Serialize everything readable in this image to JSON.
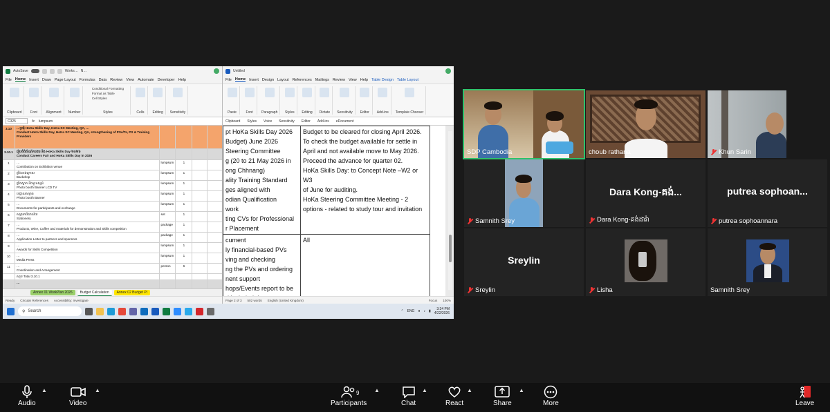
{
  "excel": {
    "autosave": "AutoSave",
    "title": "Works…",
    "title2": "N…",
    "tabs": [
      "File",
      "Home",
      "Insert",
      "Draw",
      "Page Layout",
      "Formulas",
      "Data",
      "Review",
      "View",
      "Automate",
      "Developer",
      "Help"
    ],
    "active_tab": "Home",
    "groups": [
      "Clipboard",
      "Font",
      "Alignment",
      "Number",
      "Cells",
      "Editing",
      "Sensitivity"
    ],
    "styles": [
      "Conditional Formatting",
      "Format as Table",
      "Cell Styles"
    ],
    "styles_label": "Styles",
    "namebox": "C325",
    "fx": "fx",
    "formula": "lumpsum",
    "rows": [
      {
        "num": "3.10",
        "desc_km": "…ប្រជុំ HoKa Skills Day, HoKa SC Meeting, QA, …",
        "desc_en": "Conduct HoKa Skills Day, HoKa SC Meeting, QA, strengthening of PSs/Ts, PS & Training Providers",
        "unit": "",
        "qty": "",
        "style": "orange"
      },
      {
        "num": "3.10.1",
        "desc_km": "រៀបចំពិព័រណ៍ការងារ និង HoKa Skills Day ២០២៦",
        "desc_en": "Conduct Careers Fair and HoKa Skills Day in 2026",
        "unit": "",
        "qty": "",
        "style": "grey"
      },
      {
        "num": "1",
        "desc_km": "…",
        "desc_en": "Contribution on Exhibition venue",
        "unit": "lumpsum",
        "qty": "1",
        "style": ""
      },
      {
        "num": "2",
        "desc_km": "ផ្ទាំងខាងក្រោយ",
        "desc_en": "Backdrop",
        "unit": "lumpsum",
        "qty": "1",
        "style": ""
      },
      {
        "num": "3",
        "desc_km": "ផ្ទាំងស្លាក និងទូរទស្សន៍",
        "desc_en": "Photo booth Banner LCD TV",
        "unit": "lumpsum",
        "qty": "1",
        "style": ""
      },
      {
        "num": "4",
        "desc_km": "បង្គោលសម្ពាធ",
        "desc_en": "Photo booth Banner",
        "unit": "lumpsum",
        "qty": "1",
        "style": ""
      },
      {
        "num": "5",
        "desc_km": "…",
        "desc_en": "Documents for participants and exchange",
        "unit": "lumpsum",
        "qty": "1",
        "style": ""
      },
      {
        "num": "6",
        "desc_km": "សម្ភារការិយាល័យ",
        "desc_en": "Stationery",
        "unit": "set",
        "qty": "1",
        "style": ""
      },
      {
        "num": "7",
        "desc_km": "…",
        "desc_en": "Products, Wine, Coffee and materials for demonstration and Skills competition",
        "unit": "package",
        "qty": "1",
        "style": ""
      },
      {
        "num": "8",
        "desc_km": "…",
        "desc_en": "Application Letter to partners and sponsors",
        "unit": "package",
        "qty": "1",
        "style": ""
      },
      {
        "num": "9",
        "desc_km": "…",
        "desc_en": "Awards for Skills Competition",
        "unit": "lumpsum",
        "qty": "1",
        "style": ""
      },
      {
        "num": "10",
        "desc_km": "…",
        "desc_en": "Media Press",
        "unit": "lumpsum",
        "qty": "1",
        "style": ""
      },
      {
        "num": "11",
        "desc_km": "…",
        "desc_en": "Coordination and Arrangement",
        "unit": "person",
        "qty": "6",
        "style": ""
      },
      {
        "num": "",
        "desc_km": "សរុប Total 3.10.1",
        "desc_en": "",
        "unit": "",
        "qty": "",
        "style": ""
      },
      {
        "num": "",
        "desc_km": "…",
        "desc_en": "",
        "unit": "",
        "qty": "",
        "style": "grey"
      }
    ],
    "sheet_tabs": [
      "Annex 01 WorkPlan 2026",
      "Budget Calculation",
      "Annex 02 Budget Pl"
    ],
    "status": [
      "Ready",
      "Circular References",
      "Accessibility: Investigate"
    ]
  },
  "word": {
    "title": "Untitled",
    "tabs": [
      "File",
      "Home",
      "Insert",
      "Design",
      "Layout",
      "References",
      "Mailings",
      "Review",
      "View",
      "Help",
      "Table Design",
      "Table Layout"
    ],
    "active_tab": "Home",
    "groups": [
      "Paste",
      "Font",
      "Paragraph",
      "Styles",
      "Editing",
      "Dictate",
      "Sensitivity",
      "Editor",
      "Add-ins",
      "Template Chooser"
    ],
    "group_labels": [
      "Clipboard",
      "Styles",
      "Voice",
      "Sensitivity",
      "Editor",
      "Add-ins",
      "eDocument"
    ],
    "left_lines": [
      "pt HoKa Skills Day 2026",
      "Budget) June 2026",
      "Steering Committee",
      "g (20 to 21 May 2026 in",
      "ong Chhnang)",
      "ality Training Standard",
      "ges aligned with",
      "odian Qualification",
      "work",
      "ting CVs for Professional",
      "r Placement",
      "cument",
      "ly financial-based PVs",
      "ving and checking",
      "ng the PVs and ordering",
      "nent support",
      "hops/Events report to be",
      "d included data"
    ],
    "right_lines": [
      "Budget to be cleared for closing April 2026.",
      "To check the budget available for settle in",
      "April and not available move to May 2026.",
      "Proceed the advance for quarter 02.",
      "HoKa Skills Day: to Concept Note –W2 or W3",
      "of June for auditing.",
      "HoKa Steering Committee Meeting - 2",
      "options - related to study tour and invitation"
    ],
    "right2": "All",
    "status": [
      "Page 2 of 3",
      "502 words",
      "English (United Kingdom)",
      "Focus",
      "100%"
    ]
  },
  "taskbar": {
    "search": "Search",
    "lang": "ENG",
    "time": "3:34 PM",
    "date": "4/22/2026"
  },
  "participants": [
    {
      "name": "SDP Cambodia",
      "muted": false,
      "video": true,
      "speaking": true
    },
    {
      "name": "choub rathana",
      "muted": false,
      "video": true,
      "speaking": false
    },
    {
      "name": "Khun Sarin",
      "muted": true,
      "video": true,
      "speaking": false
    },
    {
      "name": "Samnith Srey",
      "muted": true,
      "video": true,
      "speaking": false
    },
    {
      "name": "Dara Kong-គង់ដារ៉ា",
      "display": "Dara Kong-គង់...",
      "muted": true,
      "video": false,
      "speaking": false
    },
    {
      "name": "putrea sophoannara",
      "display": "putrea sophoan...",
      "muted": true,
      "video": false,
      "speaking": false
    },
    {
      "name": "Sreylin",
      "display": "Sreylin",
      "muted": true,
      "video": false,
      "speaking": false
    },
    {
      "name": "Lisha",
      "muted": true,
      "video": true,
      "speaking": false
    },
    {
      "name": "Samnith Srey",
      "muted": false,
      "video": true,
      "speaking": false
    }
  ],
  "toolbar": {
    "audio": "Audio",
    "video": "Video",
    "participants": "Participants",
    "participants_count": "9",
    "chat": "Chat",
    "react": "React",
    "share": "Share",
    "more": "More",
    "leave": "Leave"
  },
  "colors": {
    "speaking": "#2ec26b",
    "muted": "#e33333",
    "excel_green": "#107c41",
    "word_blue": "#185abd",
    "budget_orange": "#f4a46c"
  }
}
